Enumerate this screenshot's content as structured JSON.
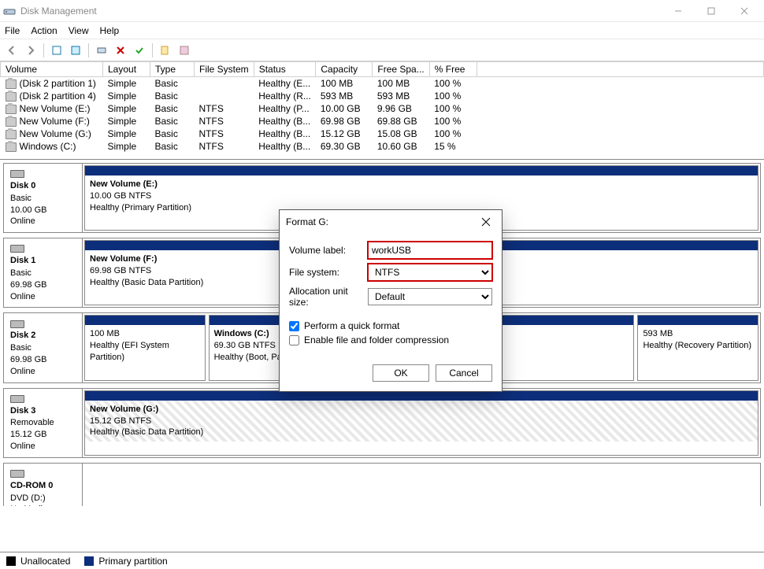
{
  "window": {
    "title": "Disk Management"
  },
  "menu": {
    "file": "File",
    "action": "Action",
    "view": "View",
    "help": "Help"
  },
  "columns": {
    "volume": "Volume",
    "layout": "Layout",
    "type": "Type",
    "fs": "File System",
    "status": "Status",
    "capacity": "Capacity",
    "free": "Free Spa...",
    "pctfree": "% Free"
  },
  "volumes": [
    {
      "name": "(Disk 2 partition 1)",
      "layout": "Simple",
      "type": "Basic",
      "fs": "",
      "status": "Healthy (E...",
      "capacity": "100 MB",
      "free": "100 MB",
      "pct": "100 %"
    },
    {
      "name": "(Disk 2 partition 4)",
      "layout": "Simple",
      "type": "Basic",
      "fs": "",
      "status": "Healthy (R...",
      "capacity": "593 MB",
      "free": "593 MB",
      "pct": "100 %"
    },
    {
      "name": "New Volume (E:)",
      "layout": "Simple",
      "type": "Basic",
      "fs": "NTFS",
      "status": "Healthy (P...",
      "capacity": "10.00 GB",
      "free": "9.96 GB",
      "pct": "100 %"
    },
    {
      "name": "New Volume (F:)",
      "layout": "Simple",
      "type": "Basic",
      "fs": "NTFS",
      "status": "Healthy (B...",
      "capacity": "69.98 GB",
      "free": "69.88 GB",
      "pct": "100 %"
    },
    {
      "name": "New Volume (G:)",
      "layout": "Simple",
      "type": "Basic",
      "fs": "NTFS",
      "status": "Healthy (B...",
      "capacity": "15.12 GB",
      "free": "15.08 GB",
      "pct": "100 %"
    },
    {
      "name": "Windows (C:)",
      "layout": "Simple",
      "type": "Basic",
      "fs": "NTFS",
      "status": "Healthy (B...",
      "capacity": "69.30 GB",
      "free": "10.60 GB",
      "pct": "15 %"
    }
  ],
  "disks": [
    {
      "label": "Disk 0",
      "kind": "Basic",
      "size": "10.00 GB",
      "state": "Online",
      "parts": [
        {
          "title": "New Volume  (E:)",
          "line2": "10.00 GB NTFS",
          "line3": "Healthy (Primary Partition)",
          "flex": 1
        }
      ]
    },
    {
      "label": "Disk 1",
      "kind": "Basic",
      "size": "69.98 GB",
      "state": "Online",
      "parts": [
        {
          "title": "New Volume  (F:)",
          "line2": "69.98 GB NTFS",
          "line3": "Healthy (Basic Data Partition)",
          "flex": 1
        }
      ]
    },
    {
      "label": "Disk 2",
      "kind": "Basic",
      "size": "69.98 GB",
      "state": "Online",
      "parts": [
        {
          "title": "",
          "line2": "100 MB",
          "line3": "Healthy (EFI System Partition)",
          "flex": 0.9
        },
        {
          "title": "Windows  (C:)",
          "line2": "69.30 GB NTFS",
          "line3": "Healthy (Boot, Pag",
          "flex": 3.2
        },
        {
          "title": "",
          "line2": "593 MB",
          "line3": "Healthy (Recovery Partition)",
          "flex": 0.9
        }
      ]
    },
    {
      "label": "Disk 3",
      "kind": "Removable",
      "size": "15.12 GB",
      "state": "Online",
      "hatched": true,
      "parts": [
        {
          "title": "New Volume  (G:)",
          "line2": "15.12 GB NTFS",
          "line3": "Healthy (Basic Data Partition)",
          "flex": 1
        }
      ]
    },
    {
      "label": "CD-ROM 0",
      "kind": "DVD (D:)",
      "size": "",
      "state": "No Media",
      "parts": []
    }
  ],
  "legend": {
    "unallocated": "Unallocated",
    "primary": "Primary partition"
  },
  "dialog": {
    "title": "Format G:",
    "labels": {
      "volume": "Volume label:",
      "fs": "File system:",
      "alloc": "Allocation unit size:"
    },
    "values": {
      "volume": "workUSB",
      "fs": "NTFS",
      "alloc": "Default"
    },
    "checks": {
      "quick": "Perform a quick format",
      "compress": "Enable file and folder compression"
    },
    "buttons": {
      "ok": "OK",
      "cancel": "Cancel"
    }
  }
}
